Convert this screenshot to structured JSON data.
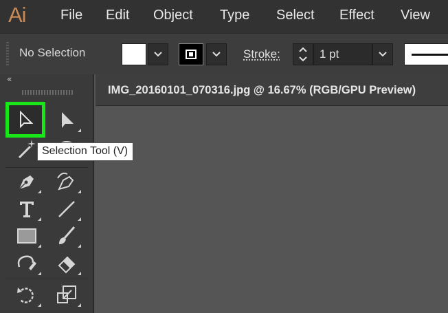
{
  "app": {
    "logo": "Ai"
  },
  "menu": {
    "items": [
      "File",
      "Edit",
      "Object",
      "Type",
      "Select",
      "Effect",
      "View"
    ]
  },
  "control_bar": {
    "selection_status": "No Selection",
    "fill_color": "#ffffff",
    "stroke_color": "#000000",
    "stroke_label": "Stroke:",
    "stroke_weight": "1 pt"
  },
  "toolbar": {
    "collapse_label": "«",
    "highlight_color": "#19e619",
    "tools": [
      "selection-tool",
      "direct-selection-tool",
      "magic-wand-tool",
      "lasso-tool",
      "pen-tool",
      "curvature-tool",
      "type-tool",
      "line-segment-tool",
      "rectangle-tool",
      "paintbrush-tool",
      "shaper-tool",
      "eraser-tool",
      "rotate-tool",
      "scale-tool"
    ]
  },
  "tooltip": {
    "text": "Selection Tool (V)"
  },
  "document": {
    "tab_title": "IMG_20160101_070316.jpg @ 16.67% (RGB/GPU Preview)"
  },
  "colors": {
    "accent": "#c98a55",
    "menubar": "#323232",
    "panel": "#3a3a3a",
    "canvas": "#555555"
  }
}
